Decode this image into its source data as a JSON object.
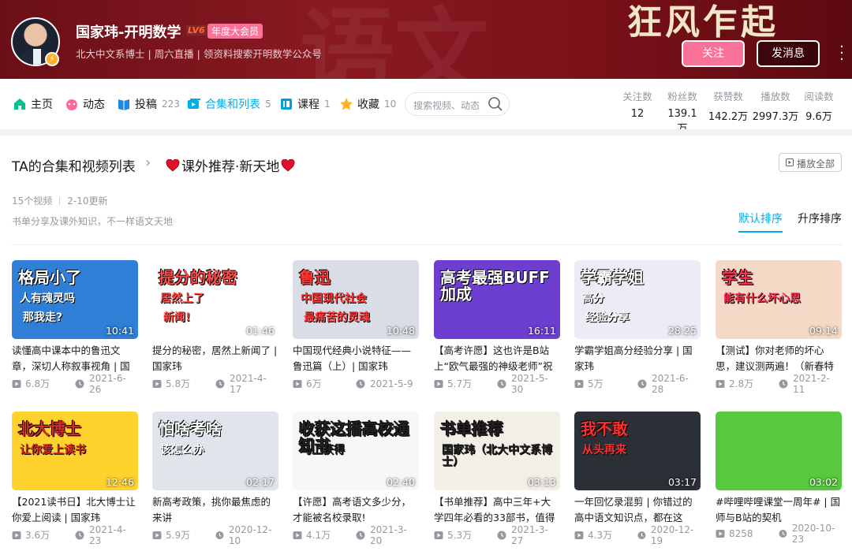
{
  "header": {
    "slogan": "狂风乍起",
    "watermark": "语文",
    "username": "国家玮-开明数学",
    "level": "LV6",
    "vip_label": "年度大会员",
    "sign": "北大中文系博士 | 周六直播 | 领资料搜索开明数学公众号",
    "follow_label": "关注",
    "message_label": "发消息"
  },
  "nav": {
    "items": [
      {
        "label": "主页",
        "count": "",
        "icon": "home-icon"
      },
      {
        "label": "动态",
        "count": "",
        "icon": "dynamic-icon"
      },
      {
        "label": "投稿",
        "count": "223",
        "icon": "upload-icon"
      },
      {
        "label": "合集和列表",
        "count": "5",
        "icon": "collection-icon"
      },
      {
        "label": "课程",
        "count": "1",
        "icon": "course-icon"
      },
      {
        "label": "收藏",
        "count": "10",
        "icon": "star-icon"
      }
    ],
    "search_placeholder": "搜索视频、动态",
    "stats": [
      {
        "label": "关注数",
        "value": "12"
      },
      {
        "label": "粉丝数",
        "value": "139.1万"
      },
      {
        "label": "获赞数",
        "value": "142.2万"
      },
      {
        "label": "播放数",
        "value": "2997.3万"
      },
      {
        "label": "阅读数",
        "value": "9.6万"
      }
    ]
  },
  "section": {
    "title": "TA的合集和视频列表",
    "arrow": "›",
    "list_name": "课外推荐·新天地",
    "play_all": "播放全部",
    "video_count": "15个视频",
    "updated": "2-10更新",
    "description": "书单分享及课外知识，不一样语文天地",
    "sort_default": "默认排序",
    "sort_asc": "升序排序"
  },
  "videos": [
    {
      "title": "读懂高中课本中的鲁迅文章，深切人称叙事视角 | 国家玮",
      "plays": "6.8万",
      "date": "2021-6-26",
      "duration": "10:41",
      "cap1": "格局小了",
      "cap2": "人有魂灵吗",
      "cap3": "那我走?",
      "bg": "#2f7fd6",
      "fg": "#ffffff"
    },
    {
      "title": "提分的秘密，居然上新闻了 | 国家玮",
      "plays": "5.8万",
      "date": "2021-4-17",
      "duration": "01:46",
      "cap1": "提分的秘密",
      "cap2": "居然上了",
      "cap3": "新闻!",
      "bg": "#ffffff",
      "fg": "#ff4a4a"
    },
    {
      "title": "中国现代经典小说特征——鲁迅篇（上）| 国家玮",
      "plays": "6万",
      "date": "2021-5-9",
      "duration": "10:48",
      "cap1": "鲁迅",
      "cap2": "中国现代社会",
      "cap3": "最痛苦的灵魂",
      "bg": "#d8dde6",
      "fg": "#ff3b3b"
    },
    {
      "title": "【高考许愿】这也许是B站上“欧气最强的神级老师”祝",
      "plays": "5.7万",
      "date": "2021-5-30",
      "duration": "16:11",
      "cap1": "高考最强BUFF加成",
      "cap2": "",
      "cap3": "",
      "bg": "#6c3fd1",
      "fg": "#ffffff"
    },
    {
      "title": "学霸学姐高分经验分享 | 国家玮",
      "plays": "5万",
      "date": "2021-6-28",
      "duration": "28:25",
      "cap1": "学霸学姐",
      "cap2": "高分",
      "cap3": "经验分享",
      "bg": "#eeeaf6",
      "fg": "#ffffff"
    },
    {
      "title": "【测试】你对老师的坏心思，建议测两遍！（新春特辑）",
      "plays": "2.8万",
      "date": "2021-2-11",
      "duration": "09:14",
      "cap1": "学生",
      "cap2": "能有什么坏心思",
      "cap3": "",
      "bg": "#f4d9c6",
      "fg": "#ff3355"
    },
    {
      "title": "【2021读书日】北大博士让你爱上阅读 | 国家玮",
      "plays": "3.6万",
      "date": "2021-4-23",
      "duration": "12:46",
      "cap1": "北大博士",
      "cap2": "让你爱上读书",
      "cap3": "",
      "bg": "#ffd22e",
      "fg": "#d52a2a"
    },
    {
      "title": "新高考政策，挑你最焦虑的来讲",
      "plays": "5.9万",
      "date": "2020-12-10",
      "duration": "02:17",
      "cap1": "怕啥考啥",
      "cap2": "该怎么办",
      "cap3": "",
      "bg": "#dfe5ea",
      "fg": "#ffffff"
    },
    {
      "title": "【许愿】高考语文多少分，才能被名校录取!",
      "plays": "4.1万",
      "date": "2021-3-20",
      "duration": "02:40",
      "cap1": "收获这播高校通知书",
      "cap2": "马上获得",
      "cap3": "",
      "bg": "#f7f7f7",
      "fg": "#222222"
    },
    {
      "title": "【书单推荐】高中三年+大学四年必看的33部书，值得收",
      "plays": "5.3万",
      "date": "2021-3-27",
      "duration": "03:13",
      "cap1": "书单推荐",
      "cap2": "国家玮（北大中文系博士）",
      "cap3": "",
      "bg": "#f3efe6",
      "fg": "#222222"
    },
    {
      "title": "一年回忆录混剪 | 你错过的高中语文知识点，都在这",
      "plays": "4.3万",
      "date": "2020-12-19",
      "duration": "03:17",
      "cap1": "我不敢",
      "cap2": "从头再来",
      "cap3": "",
      "bg": "#2b2f36",
      "fg": "#ff2d2d"
    },
    {
      "title": "#哔哩哔哩课堂一周年# | 国师与B站的契机",
      "plays": "8258",
      "date": "2020-10-23",
      "duration": "03:02",
      "cap1": "",
      "cap2": "",
      "cap3": "",
      "bg": "#58c93f",
      "fg": "#ffffff"
    }
  ]
}
